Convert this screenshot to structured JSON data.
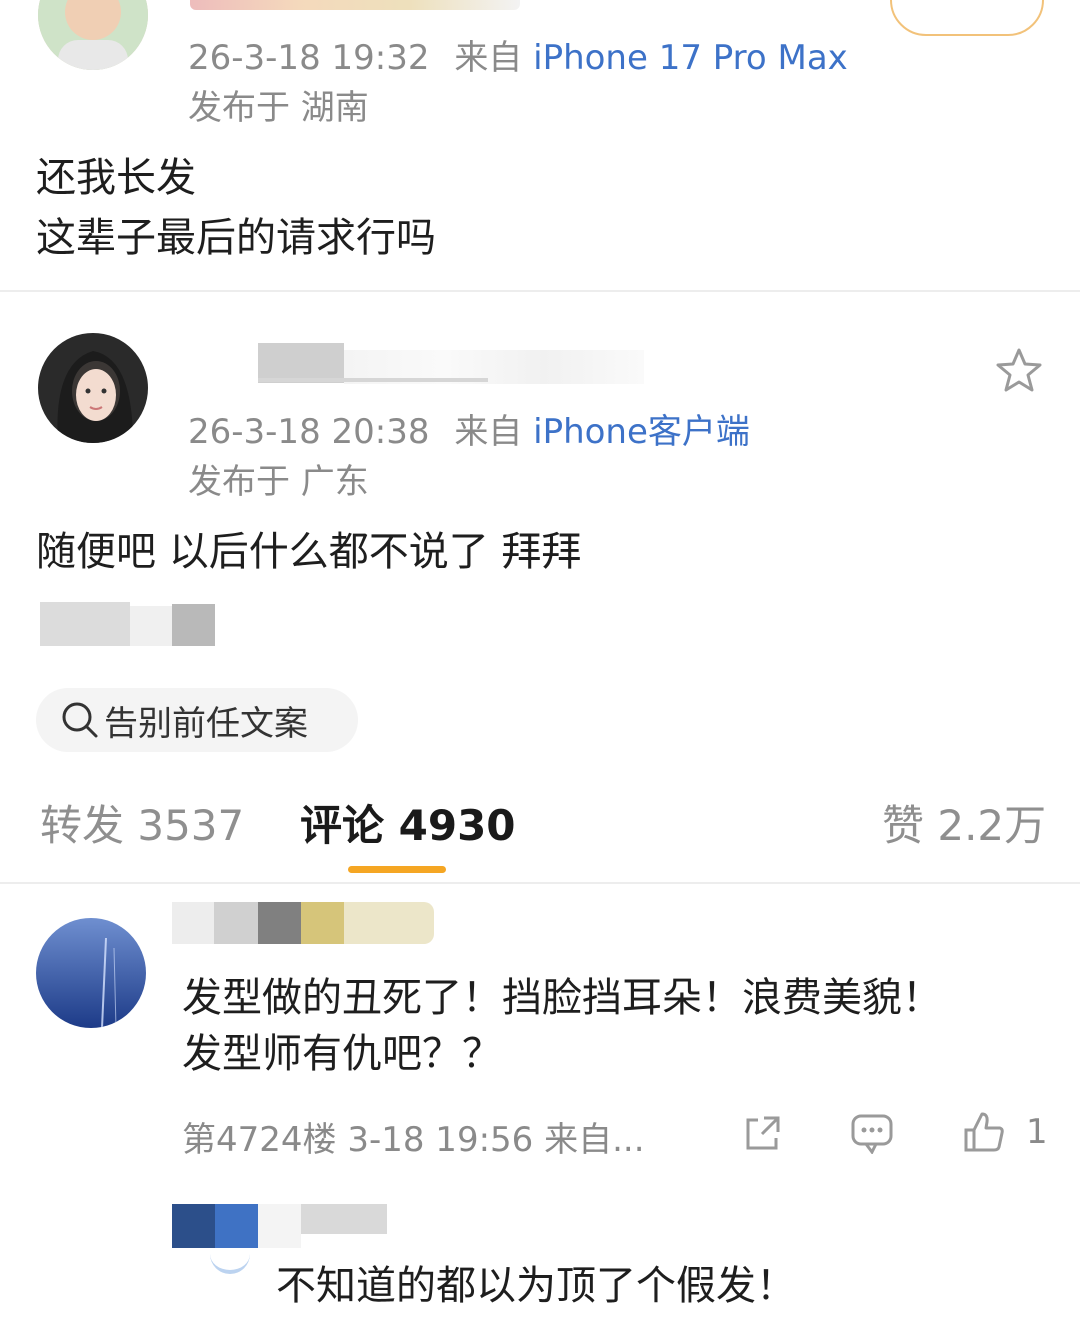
{
  "post1": {
    "avatar": "boy-avatar",
    "meta_time": "26-3-18 19:32",
    "meta_from_label": "来自",
    "meta_device": "iPhone 17 Pro Max",
    "location": "发布于 湖南",
    "lines": [
      "还我长发",
      "这辈子最后的请求行吗"
    ]
  },
  "post2": {
    "avatar": "girl-avatar",
    "meta_time": "26-3-18 20:38",
    "meta_from_label": "来自",
    "meta_device": "iPhone客户端",
    "location": "发布于 广东",
    "text": "随便吧 以后什么都不说了 拜拜",
    "topic_chip": "告别前任文案"
  },
  "tabs": {
    "repost": "转发 3537",
    "comments": "评论 4930",
    "likes": "赞 2.2万",
    "active_color": "#f5a623"
  },
  "comment1": {
    "lines": [
      "发型做的丑死了！挡脸挡耳朵！浪费美貌！",
      "发型师有仇吧？？"
    ],
    "meta": "第4724楼 3-18 19:56 来自...",
    "like_count": "1"
  },
  "reply1": {
    "text": "不知道的都以为顶了个假发！"
  },
  "colors": {
    "accent": "#f5a623",
    "link_blue": "#3d72c8",
    "meta_gray": "#8a8a8a"
  }
}
